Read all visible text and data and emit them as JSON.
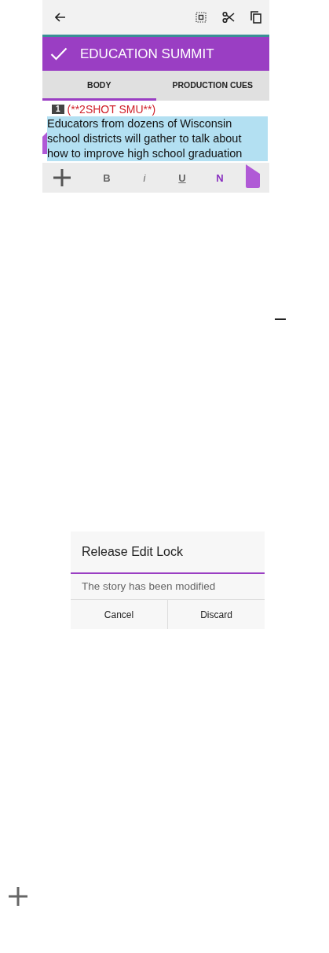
{
  "editor": {
    "title": "EDUCATION SUMMIT",
    "tabs": [
      {
        "label": "BODY",
        "selected": true
      },
      {
        "label": "PRODUCTION CUES",
        "selected": false
      }
    ],
    "slug": {
      "number": "1",
      "text": "(**2SHOT SMU**)"
    },
    "body_lines": [
      "Educators from dozens of Wisconsin",
      "school districts will gather to talk about",
      "how to improve high school graduation"
    ],
    "format_buttons": [
      {
        "label": "B",
        "kind": "bold",
        "selected": false
      },
      {
        "label": "i",
        "kind": "italic",
        "selected": false
      },
      {
        "label": "U",
        "kind": "underline",
        "selected": false
      },
      {
        "label": "N",
        "kind": "normal",
        "selected": true
      }
    ]
  },
  "dialog": {
    "title": "Release Edit Lock",
    "message": "The story has been modified",
    "buttons": [
      "Cancel",
      "Discard"
    ]
  }
}
